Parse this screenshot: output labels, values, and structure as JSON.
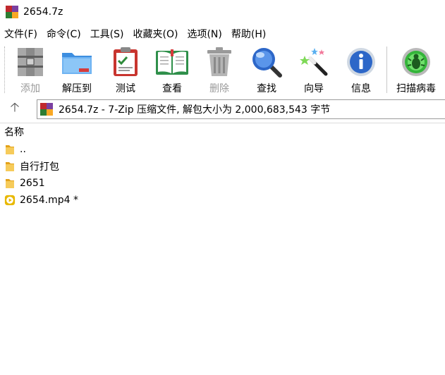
{
  "window": {
    "title": "2654.7z"
  },
  "colors": {
    "folder": "#F2C14E",
    "video": "#E8B800",
    "logo_a": "#C0282D",
    "logo_b": "#7A3FA0",
    "logo_c": "#2E7D32",
    "logo_d": "#F9A825"
  },
  "menu": {
    "items": [
      {
        "label": "文件(F)"
      },
      {
        "label": "命令(C)"
      },
      {
        "label": "工具(S)"
      },
      {
        "label": "收藏夹(O)"
      },
      {
        "label": "选项(N)"
      },
      {
        "label": "帮助(H)"
      }
    ]
  },
  "toolbar": {
    "add": {
      "label": "添加",
      "icon": "archive-add-icon"
    },
    "extract": {
      "label": "解压到",
      "icon": "folder-extract-icon"
    },
    "test": {
      "label": "测试",
      "icon": "clipboard-check-icon"
    },
    "view": {
      "label": "查看",
      "icon": "open-book-icon"
    },
    "delete": {
      "label": "删除",
      "icon": "trash-icon"
    },
    "find": {
      "label": "查找",
      "icon": "magnifier-icon"
    },
    "wizard": {
      "label": "向导",
      "icon": "magic-wand-icon"
    },
    "info": {
      "label": "信息",
      "icon": "info-icon"
    },
    "scan": {
      "label": "扫描病毒",
      "icon": "bug-scan-icon"
    }
  },
  "address": {
    "text": "2654.7z - 7-Zip 压缩文件, 解包大小为 2,000,683,543 字节",
    "up_icon": "up-arrow-icon"
  },
  "list": {
    "header_name": "名称",
    "rows": [
      {
        "name": "..",
        "type": "folder"
      },
      {
        "name": "自行打包",
        "type": "folder"
      },
      {
        "name": "2651",
        "type": "folder"
      },
      {
        "name": "2654.mp4 *",
        "type": "video"
      }
    ]
  }
}
